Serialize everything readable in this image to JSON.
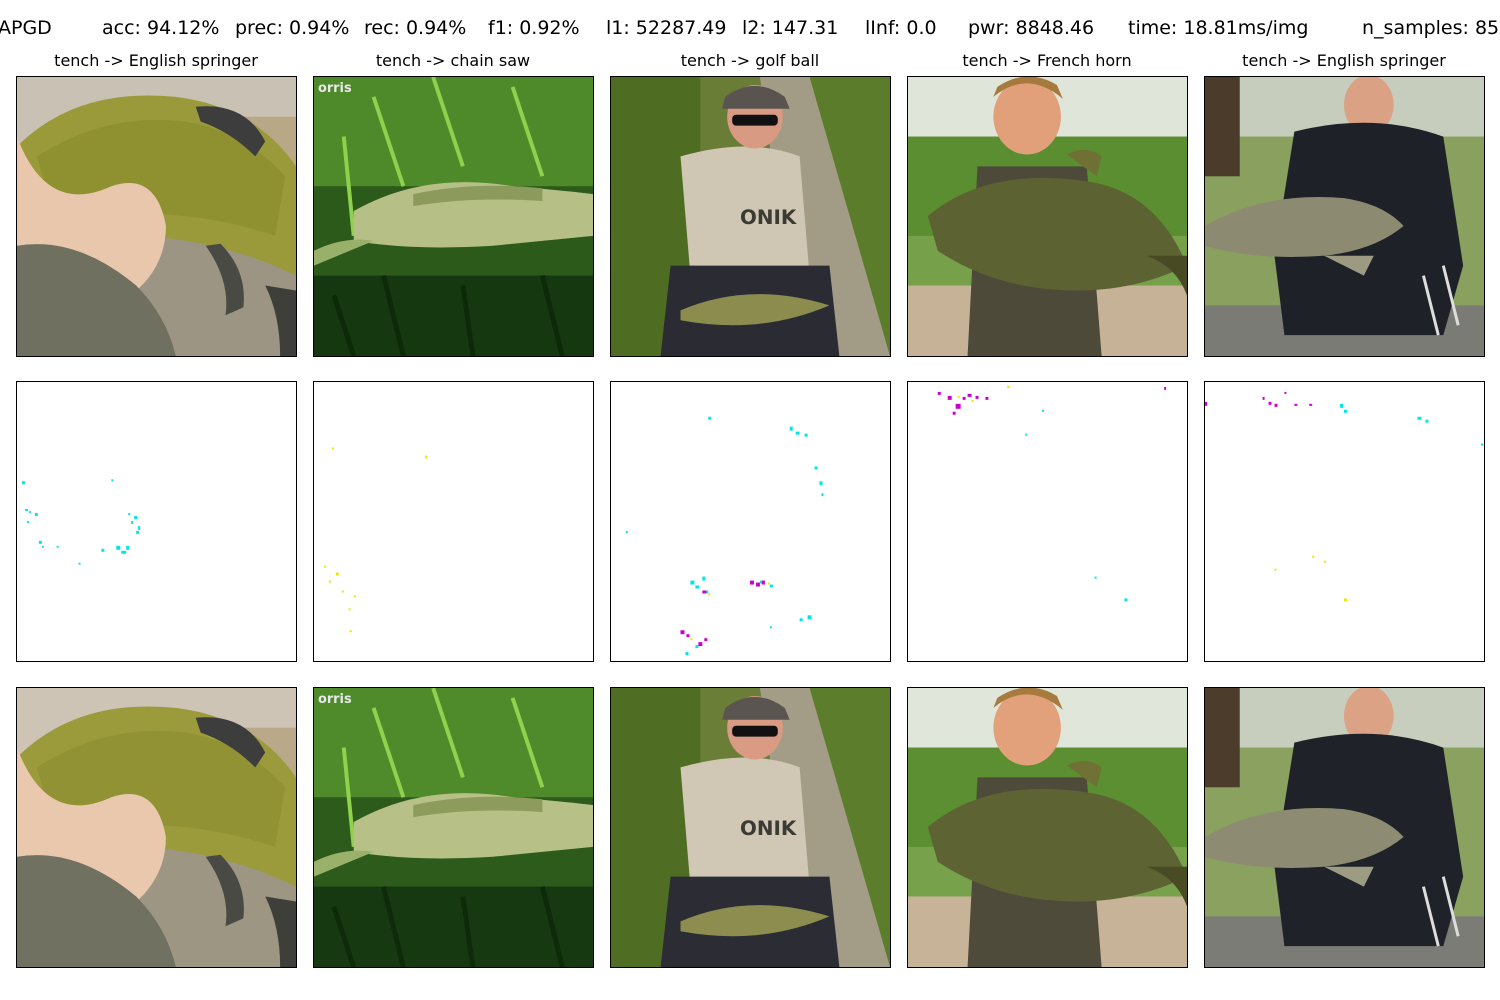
{
  "header": {
    "attack": "APGD",
    "acc": "acc: 94.12%",
    "prec": "prec: 0.94%",
    "rec": "rec: 0.94%",
    "f1": "f1: 0.92%",
    "l1": "l1: 52287.49",
    "l2": "l2: 147.31",
    "linf": "lInf: 0.0",
    "pwr": "pwr: 8848.46",
    "time": "time: 18.81ms/img",
    "n_samples": "n_samples: 85"
  },
  "columns": [
    {
      "title": "tench -> English springer"
    },
    {
      "title": "tench -> chain saw",
      "image_text": "orris"
    },
    {
      "title": "tench -> golf ball",
      "image_text": "ONIK"
    },
    {
      "title": "tench -> French horn"
    },
    {
      "title": "tench -> English springer"
    }
  ],
  "perturbation_colors": {
    "cyan": "#00e5e5",
    "magenta": "#cc00cc",
    "yellow": "#e8e800"
  }
}
